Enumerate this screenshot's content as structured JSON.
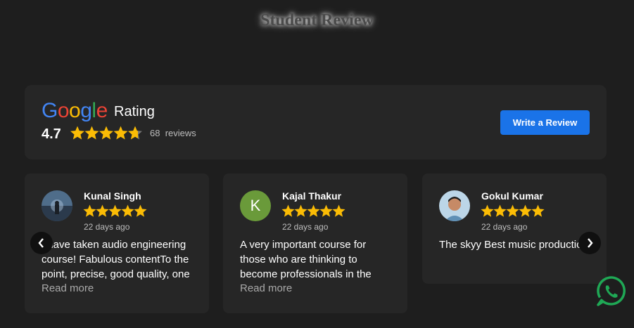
{
  "page": {
    "title": "Student Review"
  },
  "rating_panel": {
    "logo_letters": [
      "G",
      "o",
      "o",
      "g",
      "l",
      "e"
    ],
    "label": "Rating",
    "score": "4.7",
    "stars_value": 4.7,
    "review_count": "68",
    "review_word": "reviews",
    "write_button": "Write a Review",
    "accent": "#1a73e8",
    "star_color": "#FBBC05"
  },
  "reviews": [
    {
      "name": "Kunal Singh",
      "rating": 5,
      "date": "22 days ago",
      "text": "I have taken audio engineering course! Fabulous contentTo the point, precise, good quality, one",
      "read_more": "Read more",
      "avatar": "photo-avatar"
    },
    {
      "name": "Kajal Thakur",
      "rating": 5,
      "date": "22 days ago",
      "text": "A very important course for those who are thinking to become professionals in the",
      "read_more": "Read more",
      "avatar_letter": "K",
      "avatar_color": "#6a9a3a"
    },
    {
      "name": "Gokul Kumar",
      "rating": 5,
      "date": "22 days ago",
      "text": "The skyy Best music productions",
      "avatar": "photo-avatar"
    }
  ],
  "icons": {
    "prev": "chevron-left-icon",
    "next": "chevron-right-icon",
    "whatsapp": "whatsapp-icon",
    "whatsapp_color": "#1fa855"
  }
}
